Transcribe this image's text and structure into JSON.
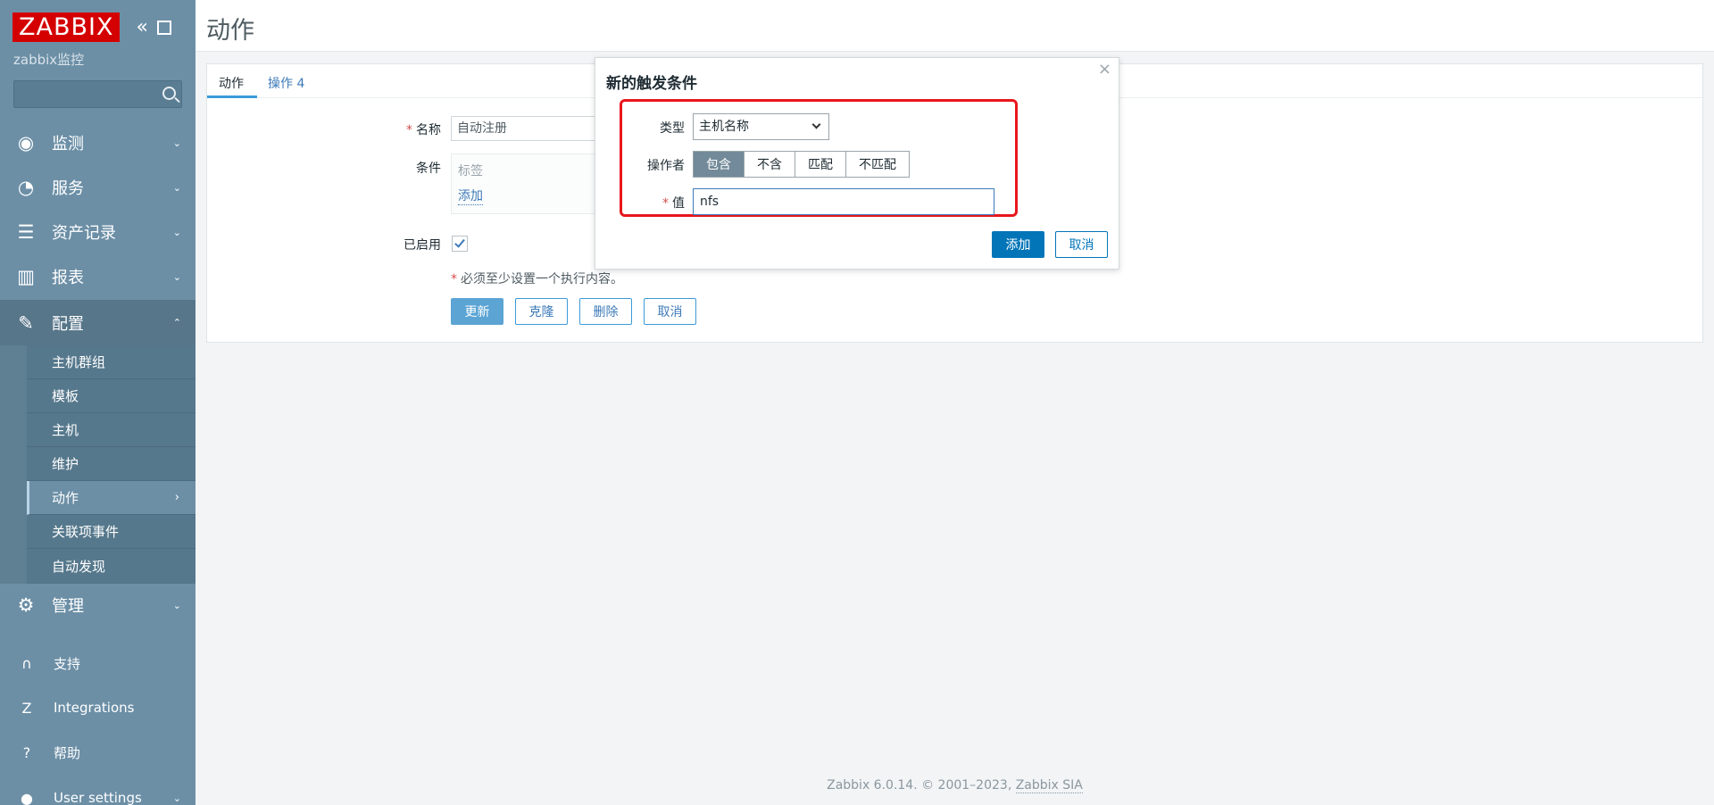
{
  "sidebar": {
    "logo": "ZABBIX",
    "collapse_icon": "«",
    "server_name": "zabbix监控",
    "menu": [
      {
        "label": "监测",
        "icon": "eye-icon"
      },
      {
        "label": "服务",
        "icon": "stopwatch-icon"
      },
      {
        "label": "资产记录",
        "icon": "list-icon"
      },
      {
        "label": "报表",
        "icon": "bar-chart-icon"
      },
      {
        "label": "配置",
        "icon": "wrench-icon"
      },
      {
        "label": "管理",
        "icon": "gear-icon"
      }
    ],
    "submenu": [
      "主机群组",
      "模板",
      "主机",
      "维护",
      "动作",
      "关联项事件",
      "自动发现"
    ],
    "bottom": [
      {
        "label": "支持",
        "icon": "headset-icon"
      },
      {
        "label": "Integrations",
        "icon": "z-icon"
      },
      {
        "label": "帮助",
        "icon": "question-icon"
      },
      {
        "label": "User settings",
        "icon": "user-icon"
      }
    ]
  },
  "header": {
    "title": "动作"
  },
  "tabs": [
    {
      "label": "动作"
    },
    {
      "label": "操作 4"
    }
  ],
  "form": {
    "name_label": "名称",
    "name_value": "自动注册",
    "conditions_label": "条件",
    "conditions_column": "标签",
    "conditions_add": "添加",
    "enabled_label": "已启用",
    "hint": "必须至少设置一个执行内容。",
    "buttons": {
      "update": "更新",
      "clone": "克隆",
      "delete": "删除",
      "cancel": "取消"
    }
  },
  "dialog": {
    "title": "新的触发条件",
    "close": "×",
    "type_label": "类型",
    "type_value": "主机名称",
    "operator_label": "操作者",
    "operators": [
      "包含",
      "不含",
      "匹配",
      "不匹配"
    ],
    "operator_selected": 0,
    "value_label": "值",
    "value": "nfs",
    "add_button": "添加",
    "cancel_button": "取消"
  },
  "footer": {
    "text": "Zabbix 6.0.14. © 2001–2023,",
    "link": "Zabbix SIA"
  },
  "colors": {
    "sidebar": "#6c8fa6",
    "accent": "#0275b8",
    "highlight": "#e8161c",
    "logo": "#d40000"
  }
}
